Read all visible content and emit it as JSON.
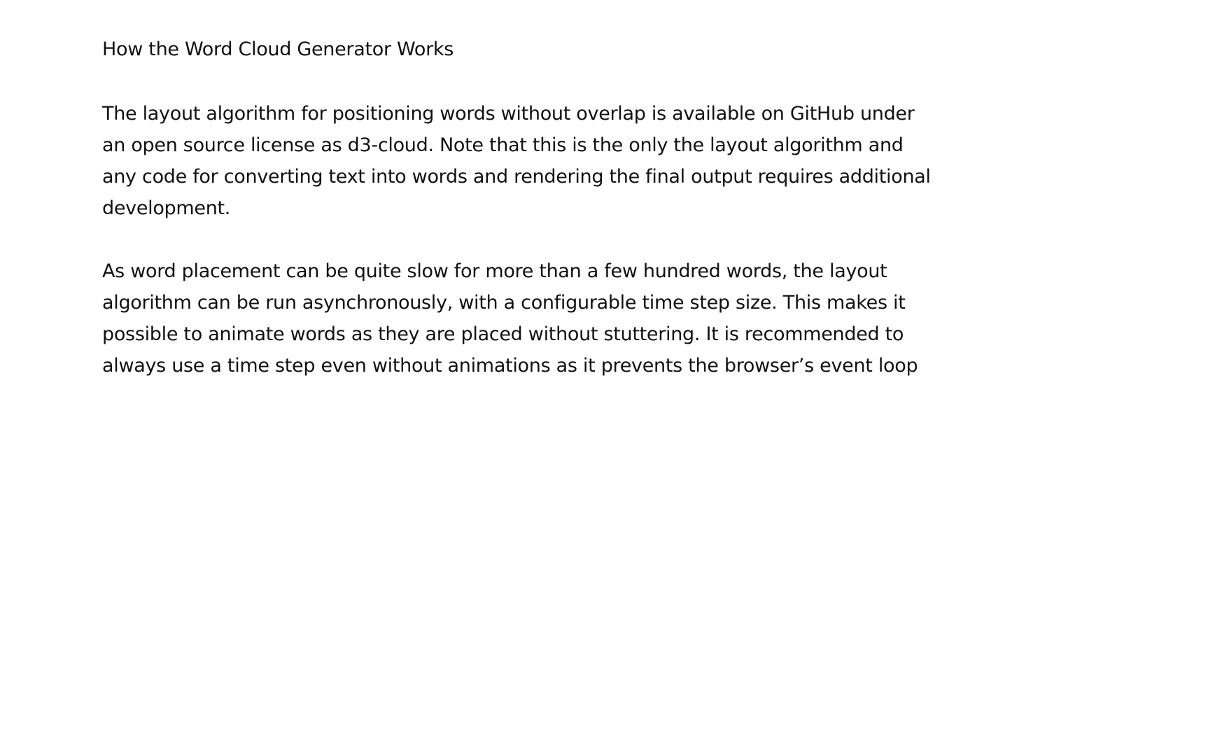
{
  "document": {
    "title": "How the Word Cloud Generator Works",
    "paragraphs": [
      "The layout algorithm for positioning words without overlap is available on GitHub under an open source license as d3-cloud. Note that this is the only the layout algorithm and any code for converting text into words and rendering the final output requires additional development.",
      "As word placement can be quite slow for more than a few hundred words, the layout algorithm can be run asynchronously, with a configurable time step size. This makes it possible to animate words as they are placed without stuttering. It is recommended to always use a time step even without animations as it prevents the browser’s event loop"
    ]
  }
}
